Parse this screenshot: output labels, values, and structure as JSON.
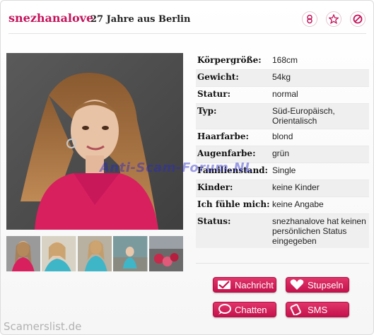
{
  "header": {
    "username": "snezhanalove",
    "subtitle": "27 Jahre aus Berlin"
  },
  "profile": {
    "rows": [
      {
        "label": "Körpergröße:",
        "value": "168cm"
      },
      {
        "label": "Gewicht:",
        "value": "54kg"
      },
      {
        "label": "Statur:",
        "value": "normal"
      },
      {
        "label": "Typ:",
        "value": "Süd-Europäisch, Orientalisch"
      },
      {
        "label": "Haarfarbe:",
        "value": "blond"
      },
      {
        "label": "Augenfarbe:",
        "value": "grün"
      },
      {
        "label": "Familienstand:",
        "value": "Single"
      },
      {
        "label": "Kinder:",
        "value": "keine Kinder"
      },
      {
        "label": "Ich fühle mich:",
        "value": "keine Angabe"
      },
      {
        "label": "Status:",
        "value": "snezhanalove hat keinen persönlichen Status eingegeben"
      }
    ]
  },
  "actions": {
    "message": "Nachricht",
    "poke": "Stupseln",
    "chat": "Chatten",
    "sms": "SMS"
  },
  "watermarks": {
    "center": "Anti-Scam-Forum.NL",
    "bottom": "Scamerslist.de"
  },
  "colors": {
    "accent": "#c4145a",
    "button": "#d42460"
  },
  "icons": [
    "gift-icon",
    "star-icon",
    "block-icon",
    "envelope-check-icon",
    "heart-icon",
    "speech-bubble-icon",
    "phone-icon"
  ]
}
